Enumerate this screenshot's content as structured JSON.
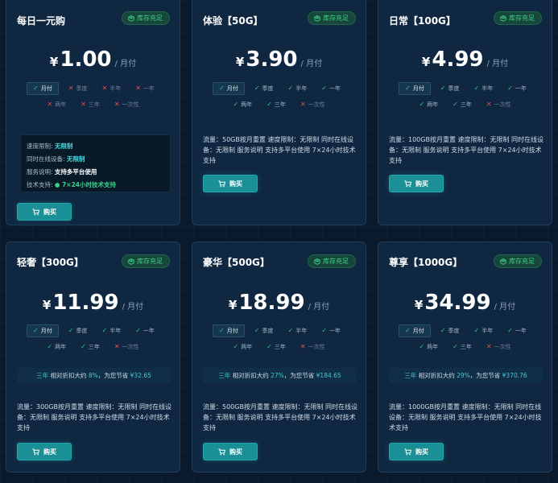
{
  "stock_label": "库存充足",
  "buy_label": "购买",
  "currency": "¥",
  "unit": "/ 月付",
  "period_labels": [
    "月付",
    "季度",
    "半年",
    "一年",
    "两年",
    "三年",
    "一次性"
  ],
  "specs_labels": {
    "speed": "速度限制:",
    "devices": "同时在线设备:",
    "service": "服务说明:",
    "support": "技术支持:"
  },
  "discount_text": {
    "period": "三年",
    "mid": "相对折扣大约",
    "save": "为您节省"
  },
  "colors": {
    "accent": "#1a9096",
    "ok": "#35c784",
    "no": "#d9534f",
    "highlight": "#45d8e0"
  },
  "plans": [
    {
      "title": "每日一元购",
      "price": "1.00",
      "periods_available": [
        true,
        false,
        false,
        false,
        false,
        false,
        false
      ],
      "specs": {
        "speed": "无限制",
        "devices": "无限制",
        "service": "支持多平台使用",
        "support": "7×24小时技术支持"
      }
    },
    {
      "title": "体验【50G】",
      "price": "3.90",
      "periods_available": [
        true,
        true,
        true,
        true,
        true,
        true,
        false
      ],
      "desc": "流量：50GB按月重置 速度限制：无限制 同时在线设备：无限制 服务说明 支持多平台使用 7×24小时技术支持"
    },
    {
      "title": "日常【100G】",
      "price": "4.99",
      "periods_available": [
        true,
        true,
        true,
        true,
        true,
        true,
        false
      ],
      "desc": "流量：100GB按月重置 速度限制：无限制 同时在线设备：无限制 服务说明 支持多平台使用 7×24小时技术支持"
    },
    {
      "title": "轻奢【300G】",
      "price": "11.99",
      "periods_available": [
        true,
        true,
        true,
        true,
        true,
        true,
        false
      ],
      "discount": {
        "percent": "8%",
        "amount": "¥32.65"
      },
      "desc": "流量：300GB按月重置 速度限制：无限制 同时在线设备：无限制 服务说明 支持多平台使用 7×24小时技术支持"
    },
    {
      "title": "豪华【500G】",
      "price": "18.99",
      "periods_available": [
        true,
        true,
        true,
        true,
        true,
        true,
        false
      ],
      "discount": {
        "percent": "27%",
        "amount": "¥184.65"
      },
      "desc": "流量：500GB按月重置 速度限制：无限制 同时在线设备：无限制 服务说明 支持多平台使用 7×24小时技术支持"
    },
    {
      "title": "尊享【1000G】",
      "price": "34.99",
      "periods_available": [
        true,
        true,
        true,
        true,
        true,
        true,
        false
      ],
      "discount": {
        "percent": "29%",
        "amount": "¥370.76"
      },
      "desc": "流量：1000GB按月重置 速度限制：无限制 同时在线设备：无限制 服务说明 支持多平台使用 7×24小时技术支持"
    }
  ]
}
